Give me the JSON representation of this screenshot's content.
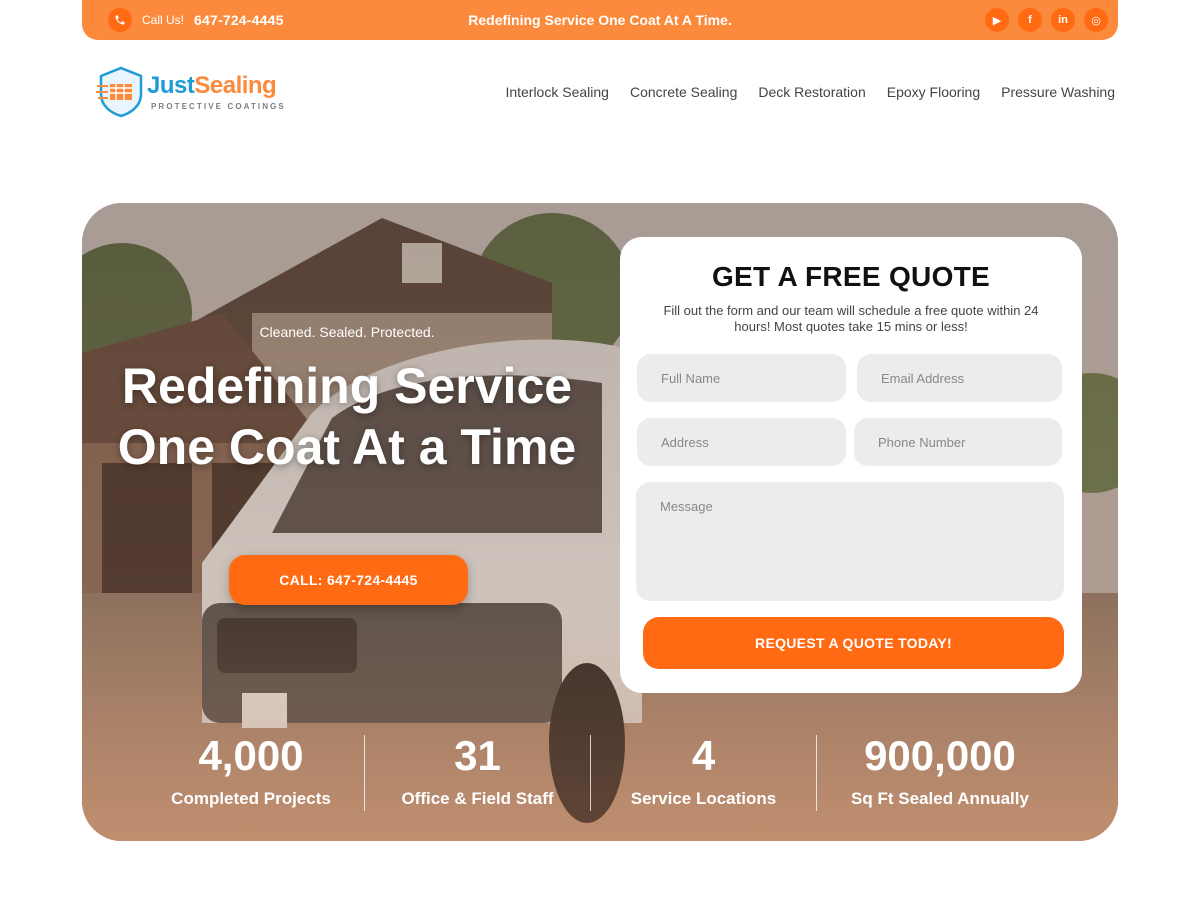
{
  "topbar": {
    "call_label": "Call Us!",
    "phone": "647-724-4445",
    "tagline": "Redefining Service One Coat At A Time.",
    "social": [
      {
        "icon": "youtube-icon",
        "glyph": "▶"
      },
      {
        "icon": "facebook-icon",
        "glyph": "f"
      },
      {
        "icon": "linkedin-icon",
        "glyph": "in"
      },
      {
        "icon": "instagram-icon",
        "glyph": "◎"
      }
    ]
  },
  "logo": {
    "just": "Just",
    "sealing": "Sealing",
    "sub": "PROTECTIVE COATINGS"
  },
  "nav": {
    "items": [
      "Interlock Sealing",
      "Concrete Sealing",
      "Deck Restoration",
      "Epoxy Flooring",
      "Pressure Washing"
    ]
  },
  "hero": {
    "kicker": "Cleaned. Sealed. Protected.",
    "title": "Redefining Service One Coat At a Time",
    "cta": "CALL: 647-724-4445"
  },
  "quote": {
    "title": "GET A FREE QUOTE",
    "description": "Fill out the form and our team will schedule a free quote within 24 hours! Most quotes take 15 mins or less!",
    "fields": {
      "full_name": "Full Name",
      "email": "Email Address",
      "address": "Address",
      "phone": "Phone Number",
      "message": "Message"
    },
    "submit": "REQUEST A QUOTE TODAY!"
  },
  "stats": [
    {
      "value": "4,000",
      "label": "Completed Projects"
    },
    {
      "value": "31",
      "label": "Office & Field Staff"
    },
    {
      "value": "4",
      "label": "Service Locations"
    },
    {
      "value": "900,000",
      "label": "Sq Ft Sealed Annually"
    }
  ],
  "colors": {
    "brand_orange": "#ff6a13",
    "topbar_orange": "#fb8a3c",
    "brand_blue": "#1f9bd7"
  }
}
